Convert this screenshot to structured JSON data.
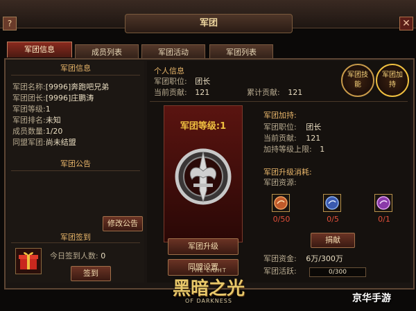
{
  "header": {
    "title": "军团",
    "help_label": "?",
    "close_label": "✕"
  },
  "tabs": [
    {
      "label": "军团信息"
    },
    {
      "label": "成员列表"
    },
    {
      "label": "军团活动"
    },
    {
      "label": "军团列表"
    }
  ],
  "info": {
    "heading": "军团信息",
    "fields": [
      {
        "label": "军团名称:",
        "value": "[9996]奔跑吧兄弟"
      },
      {
        "label": "军团团长:",
        "value": "[9996]庄鹏涛"
      },
      {
        "label": "军团等级:",
        "value": "1"
      },
      {
        "label": "军团排名:",
        "value": "未知"
      },
      {
        "label": "成员数量:",
        "value": "1/20"
      },
      {
        "label": "同盟军团:",
        "value": "尚未结盟"
      }
    ]
  },
  "notice": {
    "heading": "军团公告",
    "edit_button": "修改公告"
  },
  "signin": {
    "heading": "军团签到",
    "count_label": "今日签到人数:",
    "count_value": "0",
    "button": "签到"
  },
  "personal": {
    "heading": "个人信息",
    "position_label": "军团职位:",
    "position_value": "团长",
    "contrib_label": "当前贡献:",
    "contrib_value": "121",
    "total_label": "累计贡献:",
    "total_value": "121"
  },
  "badges": {
    "skill": "军团技能",
    "bless": "军团加持"
  },
  "banner": {
    "level_text": "军团等级:1",
    "upgrade_button": "军团升级",
    "alliance_button": "同盟设置"
  },
  "bless": {
    "heading": "军团加持:",
    "position_label": "军团职位:",
    "position_value": "团长",
    "contrib_label": "当前贡献:",
    "contrib_value": "121",
    "cap_label": "加持等级上限:",
    "cap_value": "1"
  },
  "upgrade": {
    "heading": "军团升级消耗:",
    "res_label": "军团资源:",
    "resources": [
      {
        "count": "0/50",
        "color": "#c05a2a"
      },
      {
        "count": "0/5",
        "color": "#3a5ab0"
      },
      {
        "count": "0/1",
        "color": "#8a3aa8"
      }
    ],
    "donate_button": "捐献",
    "funds_label": "军团资金:",
    "funds_value": "6万/300万",
    "activity_label": "军团活跃:",
    "activity_value": "0/300",
    "activity_progress": 0
  },
  "logo": {
    "text": "黑暗之光",
    "sub_top": "THE LIGHT",
    "sub_bottom": "OF DARKNESS"
  },
  "watermark": {
    "text": "京华手游"
  }
}
